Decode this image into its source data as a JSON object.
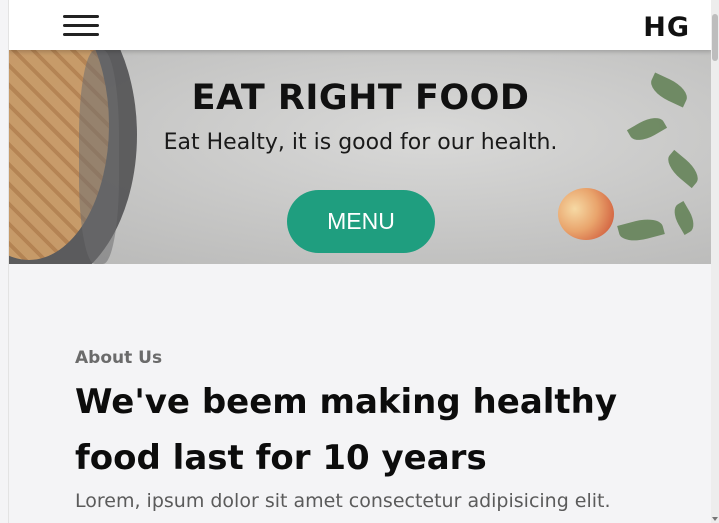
{
  "header": {
    "logo": "HG",
    "menu_icon": "hamburger-icon"
  },
  "hero": {
    "title": "EAT RIGHT FOOD",
    "subtitle": "Eat Healty, it is good for our health.",
    "button_label": "MENU"
  },
  "about": {
    "eyebrow": "About Us",
    "heading": "We've beem making healthy food last for 10 years",
    "body": "Lorem, ipsum dolor sit amet consectetur adipisicing elit."
  },
  "colors": {
    "accent": "#1f9e7f",
    "background": "#f4f4f6",
    "text": "#0c0c0c"
  }
}
